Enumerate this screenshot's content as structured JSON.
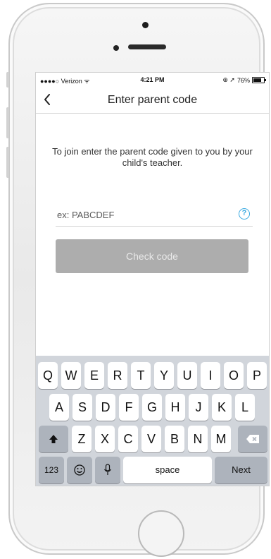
{
  "status_bar": {
    "carrier": "●●●●○ Verizon ᯤ",
    "time": "4:21 PM",
    "indicators": "⊕ ➚",
    "battery_text": "76%",
    "battery_level": 0.76
  },
  "nav": {
    "title": "Enter parent code",
    "back_icon": "chevron-left-icon"
  },
  "instruction": "To join enter the parent code given to you by your child's teacher.",
  "code_input": {
    "placeholder": "ex: PABCDEF",
    "value": "",
    "help_icon": "question-circle-icon"
  },
  "check_button": {
    "label": "Check code",
    "state": "disabled"
  },
  "keyboard": {
    "row1": [
      "Q",
      "W",
      "E",
      "R",
      "T",
      "Y",
      "U",
      "I",
      "O",
      "P"
    ],
    "row2": [
      "A",
      "S",
      "D",
      "F",
      "G",
      "H",
      "J",
      "K",
      "L"
    ],
    "row3": [
      "Z",
      "X",
      "C",
      "V",
      "B",
      "N",
      "M"
    ],
    "shift_symbol": "🡅",
    "delete_symbol": "⌫",
    "numbers_label": "123",
    "emoji_symbol": "☺",
    "mic_symbol": "🎙",
    "space_label": "space",
    "next_label": "Next"
  },
  "colors": {
    "accent": "#39a9e0",
    "button_disabled": "#adadad",
    "keyboard_bg": "#d1d5db"
  }
}
